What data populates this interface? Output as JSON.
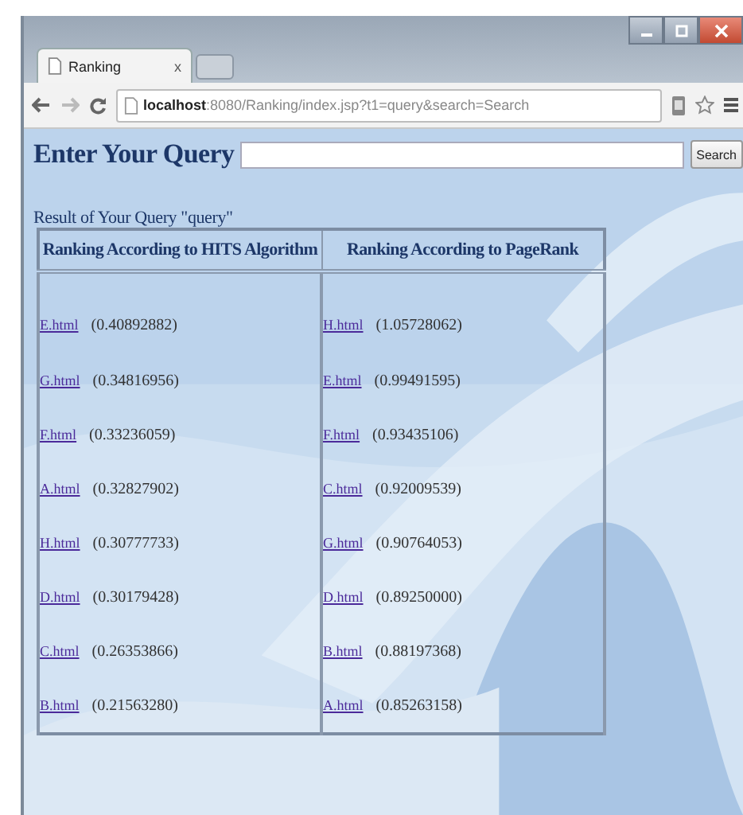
{
  "browser": {
    "tab": {
      "title": "Ranking",
      "close": "x"
    },
    "address": "**localhost**:8080/Ranking/index.jsp?t1=query&search=Search"
  },
  "query_form": {
    "heading": "Enter Your Query",
    "button": "Search"
  },
  "result_title": "Result of Your Query \"query\"",
  "table": {
    "columns": [
      "Ranking According to HITS Algorithm",
      "Ranking According to PageRank"
    ],
    "rows": [
      [
        {
          "link": "E.html",
          "score": "(0.40892882)"
        },
        {
          "link": "H.html",
          "score": "(1.05728062)"
        }
      ],
      [
        {
          "link": "G.html",
          "score": "(0.34816956)"
        },
        {
          "link": "E.html",
          "score": "(0.99491595)"
        }
      ],
      [
        {
          "link": "F.html",
          "score": "(0.33236059)"
        },
        {
          "link": "F.html",
          "score": "(0.93435106)"
        }
      ],
      [
        {
          "link": "A.html",
          "score": "(0.32827902)"
        },
        {
          "link": "C.html",
          "score": "(0.92009539)"
        }
      ],
      [
        {
          "link": "H.html",
          "score": "(0.30777733)"
        },
        {
          "link": "G.html",
          "score": "(0.90764053)"
        }
      ],
      [
        {
          "link": "D.html",
          "score": "(0.30179428)"
        },
        {
          "link": "D.html",
          "score": "(0.89250000)"
        }
      ],
      [
        {
          "link": "C.html",
          "score": "(0.26353866)"
        },
        {
          "link": "B.html",
          "score": "(0.88197368)"
        }
      ],
      [
        {
          "link": "B.html",
          "score": "(0.21563280)"
        },
        {
          "link": "A.html",
          "score": "(0.85263158)"
        }
      ]
    ]
  }
}
